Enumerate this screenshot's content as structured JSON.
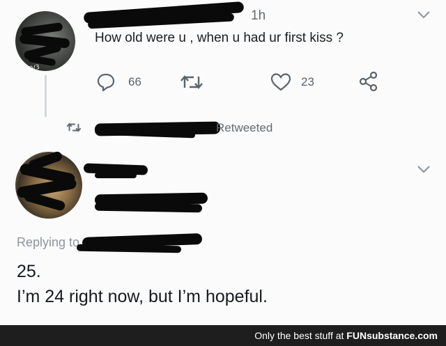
{
  "tweet": {
    "time": "1h",
    "text": "How old were u , when u had ur first kiss ?",
    "avatar_caption": "8TV3",
    "replies": "66",
    "likes": "23"
  },
  "retweet_line": {
    "text": "Retweeted"
  },
  "reply": {
    "replying_to": "Replying to",
    "line1": "25.",
    "line2": "I’m 24 right now, but I’m hopeful."
  },
  "footer": {
    "tagline": "Only the best stuff at ",
    "brand": "FUNsubstance.com"
  }
}
